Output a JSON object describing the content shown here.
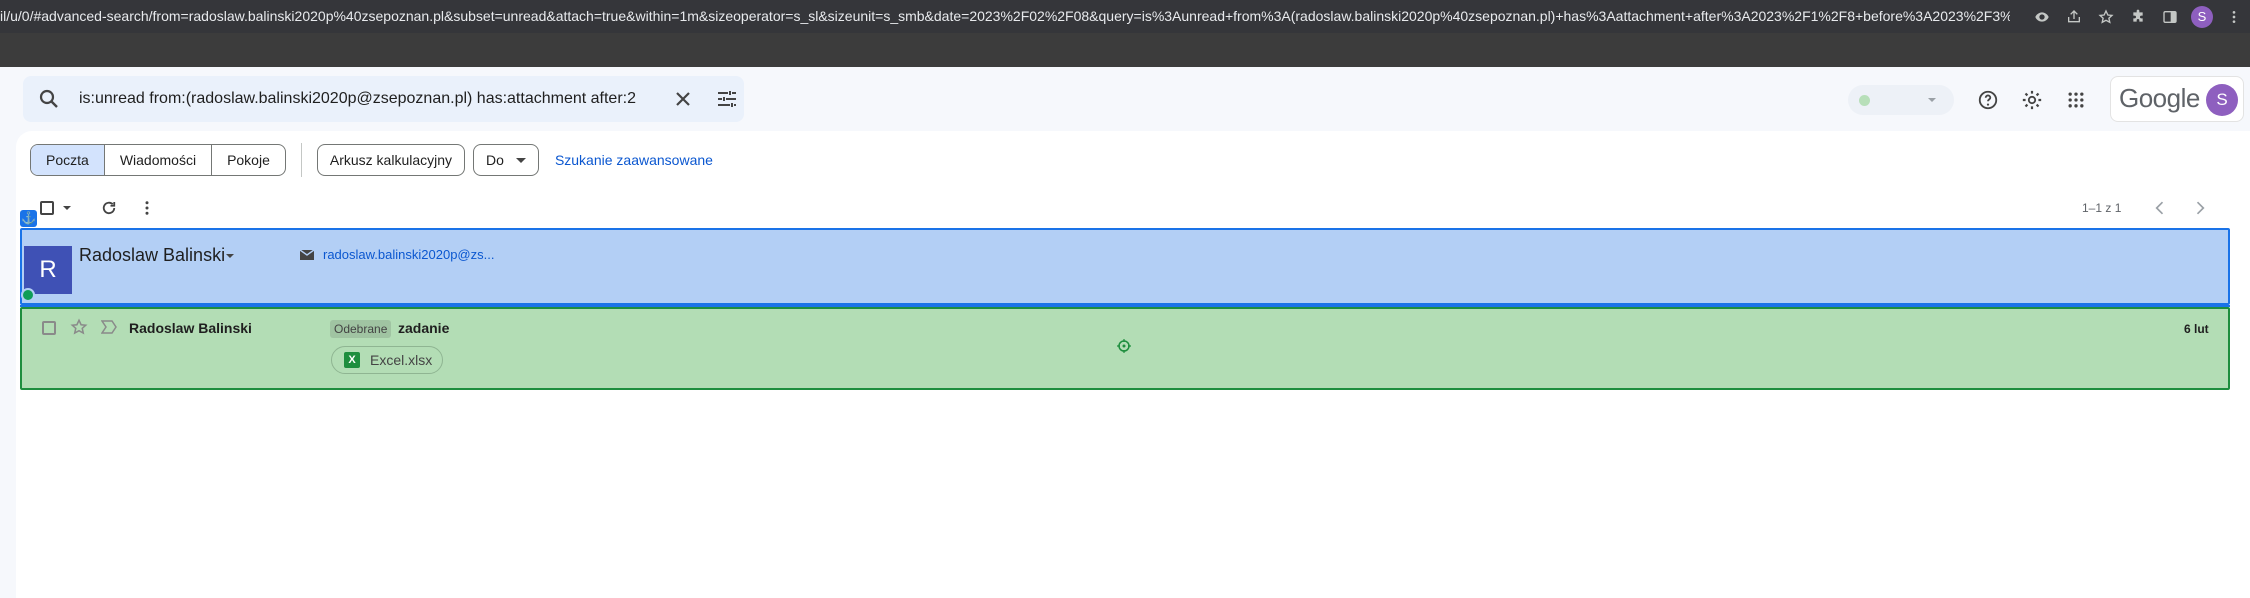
{
  "browser": {
    "url": "il/u/0/#advanced-search/from=radoslaw.balinski2020p%40zsepoznan.pl&subset=unread&attach=true&within=1m&sizeoperator=s_sl&sizeunit=s_smb&date=2023%2F02%2F08&query=is%3Aunread+from%3A(radoslaw.balinski2020p%40zsepoznan.pl)+has%3Aattachment+after%3A2023%2F1%2F8+before%3A2023%2F3%...",
    "profile_initial": "S"
  },
  "header": {
    "search_query": "is:unread from:(radoslaw.balinski2020p@zsepoznan.pl) has:attachment after:2",
    "google_logo": "Google",
    "account_initial": "S"
  },
  "chips": {
    "segments": [
      "Poczta",
      "Wiadomości",
      "Pokoje"
    ],
    "active_segment": "Poczta",
    "spreadsheet": "Arkusz kalkulacyjny",
    "to": "Do",
    "advanced_search": "Szukanie zaawansowane"
  },
  "pager": {
    "text": "1–1 z 1"
  },
  "sender_card": {
    "avatar_initial": "R",
    "name": "Radoslaw Balinski",
    "email": "radoslaw.balinski2020p@zs..."
  },
  "email_row": {
    "sender": "Radoslaw Balinski",
    "label": "Odebrane",
    "subject": "zadanie",
    "attachment": "Excel.xlsx",
    "attachment_icon_letter": "X",
    "date": "6 lut"
  }
}
